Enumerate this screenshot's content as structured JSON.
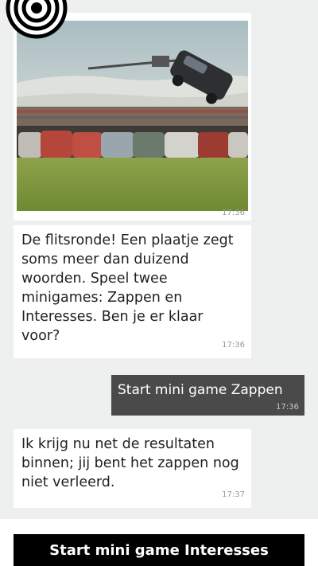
{
  "messages": [
    {
      "type": "image",
      "image_icon": "rally-car-crash-photo",
      "time": "17:36"
    },
    {
      "type": "incoming",
      "text": "De flitsronde! Een plaatje zegt soms meer dan duizend woorden. Speel twee minigames: Zappen en Interesses. Ben je er klaar voor?",
      "time": "17:36"
    },
    {
      "type": "outgoing",
      "text": "Start mini game Zappen",
      "time": "17:36"
    },
    {
      "type": "incoming",
      "text": "Ik krijg nu net de resultaten binnen; jij bent het zappen nog niet verleerd.",
      "time": "17:37"
    }
  ],
  "action": {
    "label": "Start mini game Interesses"
  },
  "logo": {
    "icon": "target-icon"
  },
  "colors": {
    "background": "#eef0f0",
    "bubble_in": "#ffffff",
    "bubble_out": "#4a4a4a",
    "button": "#000000"
  }
}
